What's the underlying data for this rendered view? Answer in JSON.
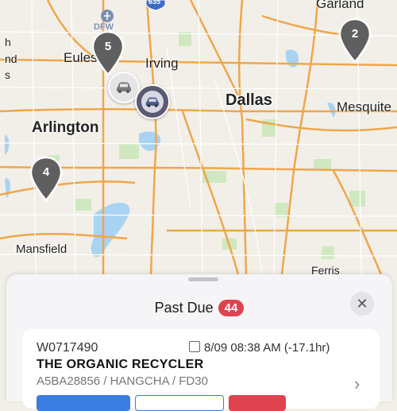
{
  "map": {
    "cities": {
      "garland": "Garland",
      "irving": "Irving",
      "euless": "Euless",
      "dallas": "Dallas",
      "mesquite": "Mesquite",
      "arlington": "Arlington",
      "mansfield": "Mansfield",
      "ferris": "Ferris",
      "dfw": "DFW",
      "partial_h": "h",
      "partial_nd": "nd",
      "partial_s": "s"
    },
    "highway_shield": "635",
    "clusters": [
      {
        "id": "cluster-5",
        "count": "5"
      },
      {
        "id": "cluster-2",
        "count": "2"
      },
      {
        "id": "cluster-4",
        "count": "4"
      }
    ]
  },
  "sheet": {
    "title": "Past Due",
    "count": "44",
    "close_label": "✕"
  },
  "order": {
    "id": "W0717490",
    "time": "8/09 08:38 AM (-17.1hr)",
    "name": "THE ORGANIC RECYCLER",
    "details": "A5BA28856 / HANGCHA / FD30",
    "chevron": "›"
  },
  "colors": {
    "badge": "#e0424f",
    "pin": "#5f5f5f",
    "action_blue": "#3b7de0",
    "action_red": "#e0424f"
  }
}
